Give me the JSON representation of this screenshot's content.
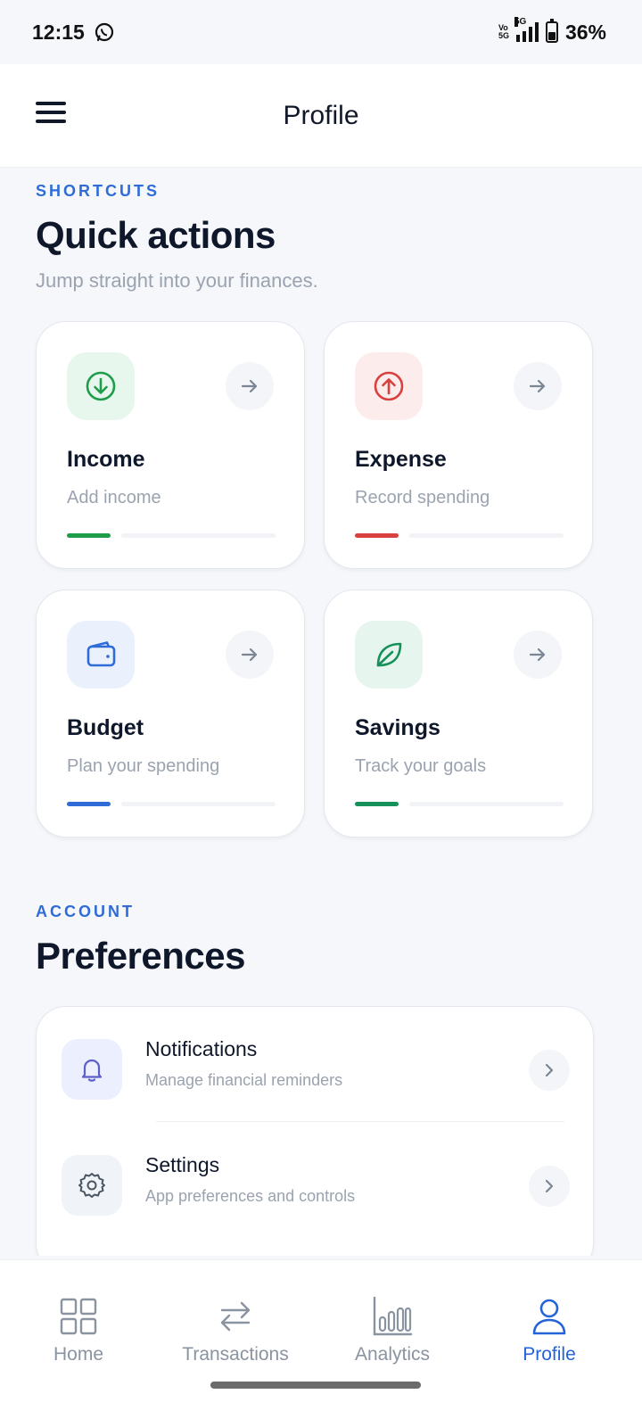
{
  "status_bar": {
    "time": "12:15",
    "battery": "36%",
    "network": "5G",
    "vo_line1": "Vo",
    "vo_line2": "5G"
  },
  "app_bar": {
    "title": "Profile",
    "menu_icon": "hamburger-menu-icon"
  },
  "shortcuts": {
    "eyebrow": "SHORTCUTS",
    "title": "Quick actions",
    "subtitle": "Jump straight into your finances.",
    "cards": [
      {
        "title": "Income",
        "subtitle": "Add income",
        "icon": "arrow-down-circle-icon",
        "accent": "#1f9d4a",
        "tint": "#e8f7ee"
      },
      {
        "title": "Expense",
        "subtitle": "Record spending",
        "icon": "arrow-up-circle-icon",
        "accent": "#d94040",
        "tint": "#fdecec"
      },
      {
        "title": "Budget",
        "subtitle": "Plan your spending",
        "icon": "wallet-icon",
        "accent": "#2f6cd8",
        "tint": "#eaf1fd"
      },
      {
        "title": "Savings",
        "subtitle": "Track your goals",
        "icon": "leaf-icon",
        "accent": "#16915a",
        "tint": "#e6f6ee"
      }
    ]
  },
  "account": {
    "eyebrow": "ACCOUNT",
    "title": "Preferences",
    "items": [
      {
        "title": "Notifications",
        "subtitle": "Manage financial reminders",
        "icon": "bell-icon",
        "tint": "#eceffd"
      },
      {
        "title": "Settings",
        "subtitle": "App preferences and controls",
        "icon": "gear-icon",
        "tint": "#f0f3f7"
      }
    ]
  },
  "bottom_nav": {
    "items": [
      {
        "label": "Home",
        "icon": "grid-icon",
        "active": false
      },
      {
        "label": "Transactions",
        "icon": "swap-arrows-icon",
        "active": false
      },
      {
        "label": "Analytics",
        "icon": "bar-chart-icon",
        "active": false
      },
      {
        "label": "Profile",
        "icon": "user-icon",
        "active": true
      }
    ]
  },
  "colors": {
    "primary": "#2563d8",
    "background": "#f5f7fa",
    "text_dark": "#0f172a",
    "text_muted": "#9aa3af"
  }
}
